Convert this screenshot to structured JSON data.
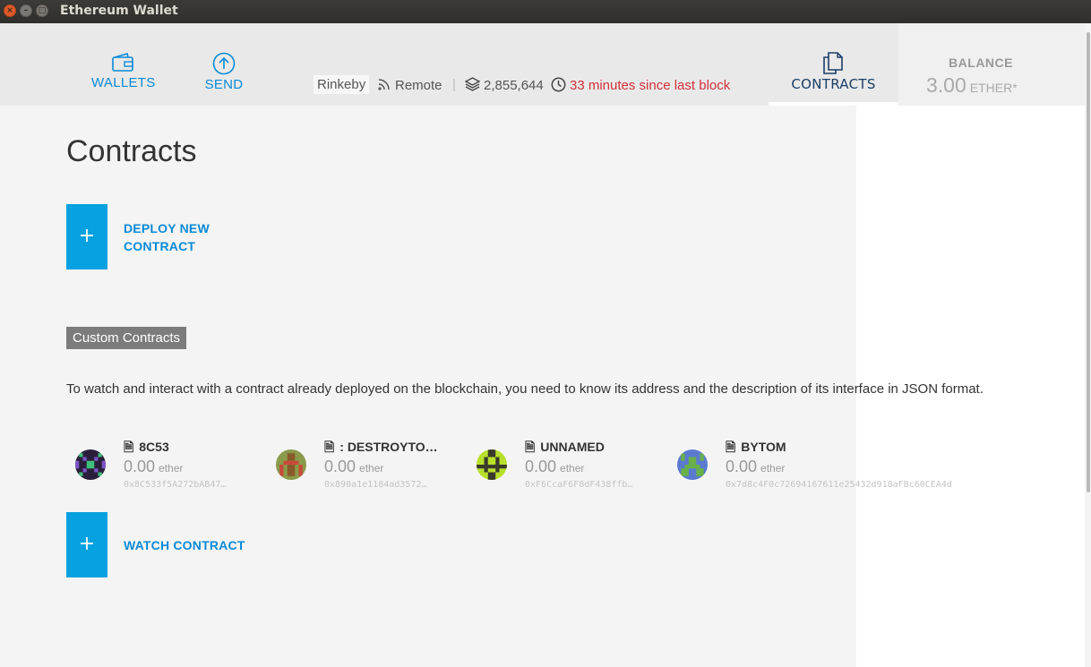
{
  "window": {
    "title": "Ethereum Wallet"
  },
  "nav": {
    "wallets_label": "WALLETS",
    "send_label": "SEND",
    "contracts_label": "CONTRACTS"
  },
  "status": {
    "network": "Rinkeby",
    "node_type": "Remote",
    "separator": "|",
    "block_number": "2,855,644",
    "since_last_block": "33 minutes since last block"
  },
  "balance": {
    "label": "BALANCE",
    "value": "3.00",
    "unit": "ETHER*"
  },
  "main": {
    "title": "Contracts",
    "deploy_plus": "+",
    "deploy_label": "DEPLOY NEW CONTRACT",
    "section_label": "Custom Contracts",
    "description": "To watch and interact with a contract already deployed on the blockchain, you need to know its address and the description of its interface in JSON format.",
    "contracts": [
      {
        "name": "8C53",
        "balance": "0.00",
        "unit": "ether",
        "address": "0x8C533f5A272bAB47…"
      },
      {
        "name": ": DESTROYTO…",
        "balance": "0.00",
        "unit": "ether",
        "address": "0x890a1e1184ad3572…"
      },
      {
        "name": "UNNAMED",
        "balance": "0.00",
        "unit": "ether",
        "address": "0xF6CcaF6F8dF438ffb…"
      },
      {
        "name": "BYTOM",
        "balance": "0.00",
        "unit": "ether",
        "address": "0x7d8c4F0c72694167611e25432d918aFBc60CEA4d"
      }
    ],
    "watch_plus": "+",
    "watch_label": "WATCH CONTRACT"
  },
  "colors": {
    "accent": "#06a1e0",
    "link": "#0a8ad6",
    "warning": "#d3303b",
    "badge": "#7c7c7c"
  },
  "icons": [
    "close-icon",
    "minimize-icon",
    "maximize-icon",
    "wallet-icon",
    "send-icon",
    "contracts-icon",
    "rss-icon",
    "layers-icon",
    "clock-icon",
    "document-icon",
    "identicon"
  ]
}
